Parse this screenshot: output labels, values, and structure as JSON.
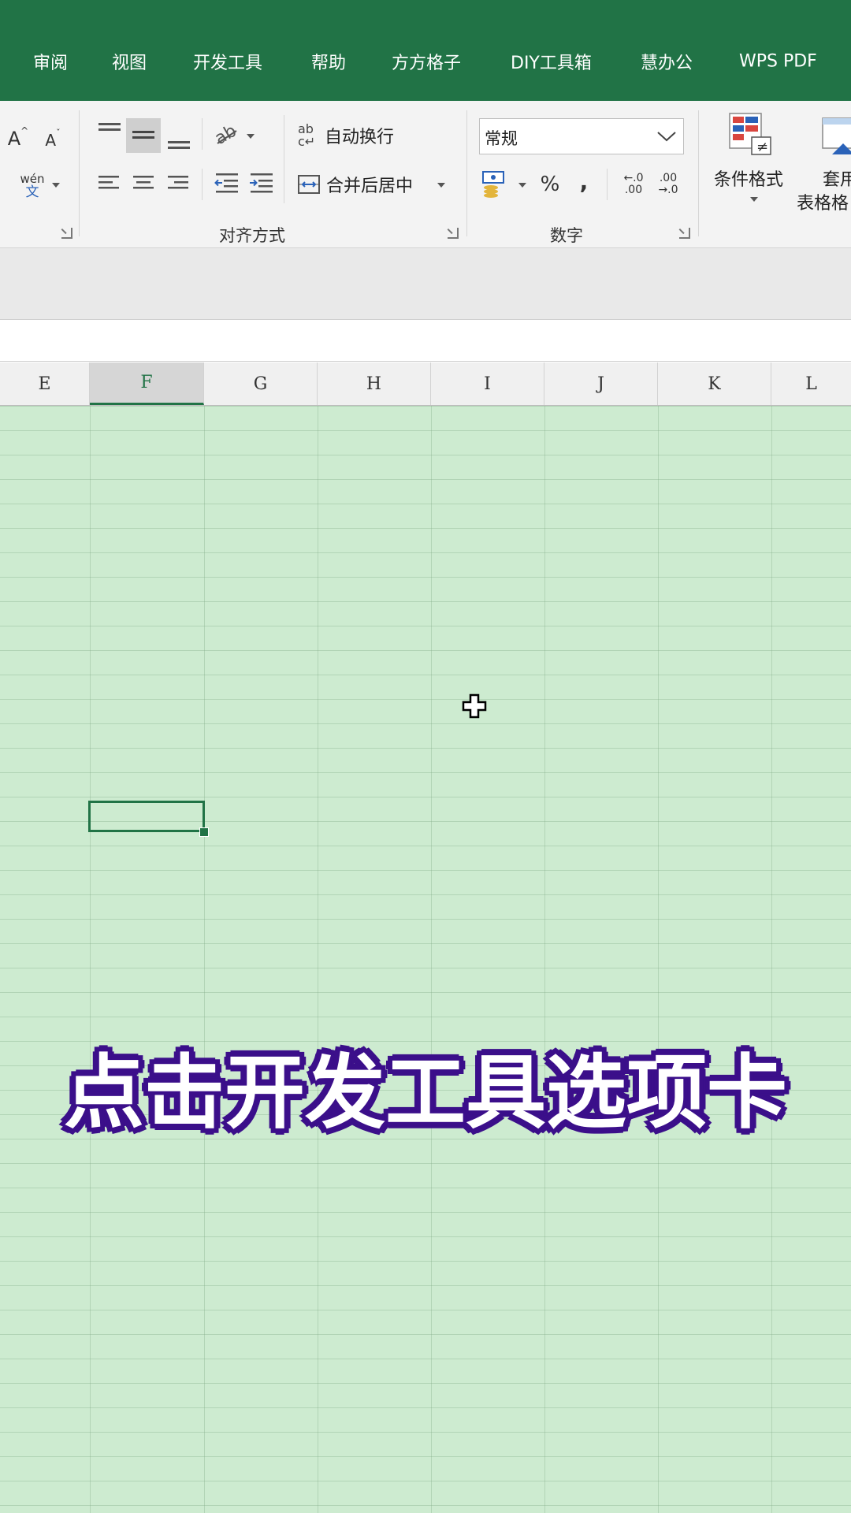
{
  "tabs": [
    "审阅",
    "视图",
    "开发工具",
    "帮助",
    "方方格子",
    "DIY工具箱",
    "慧办公",
    "WPS PDF"
  ],
  "ribbon": {
    "font": {
      "grow_label": "A",
      "shrink_label": "A",
      "phonetic_label": "wén",
      "phonetic_sub": "文"
    },
    "alignment": {
      "wrap_label": "自动换行",
      "merge_label": "合并后居中",
      "group_label": "对齐方式",
      "ab_glyph": "ab",
      "c_glyph": "c"
    },
    "number": {
      "format_value": "常规",
      "percent_label": "%",
      "comma_label": ",",
      "inc_decimal_top": "←.0",
      "inc_decimal_bottom": ".00",
      "dec_decimal_top": ".00",
      "dec_decimal_bottom": "→.0",
      "group_label": "数字"
    },
    "styles": {
      "cond_format_label": "条件格式",
      "table_format_top": "套用",
      "table_format_bottom": "表格格"
    }
  },
  "columns": [
    "E",
    "F",
    "G",
    "H",
    "I",
    "J",
    "K",
    "L"
  ],
  "selected_column": "F",
  "caption": "点击开发工具选项卡",
  "colors": {
    "ribbon_green": "#217346",
    "grid_green": "#cdebd0",
    "caption_outline": "#3b0f8a"
  }
}
